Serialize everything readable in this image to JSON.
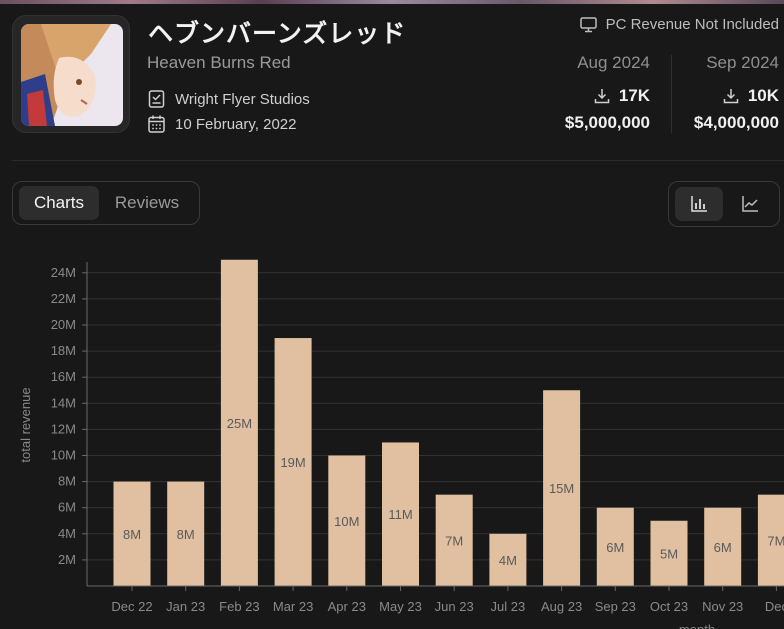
{
  "app": {
    "title": "ヘブンバーンズレッド",
    "subtitle": "Heaven Burns Red",
    "developer": "Wright Flyer Studios",
    "release_date": "10 February, 2022",
    "pc_note": "PC Revenue Not Included"
  },
  "stats": [
    {
      "month": "Aug 2024",
      "downloads": "17K",
      "revenue": "$5,000,000"
    },
    {
      "month": "Sep 2024",
      "downloads": "10K",
      "revenue": "$4,000,000"
    }
  ],
  "tabs": {
    "charts": "Charts",
    "reviews": "Reviews",
    "active": "Charts"
  },
  "view_toggle": {
    "active": "bar-chart",
    "options": [
      "bar-chart",
      "line-chart"
    ]
  },
  "icons": {
    "monitor": "monitor-icon",
    "developer": "developer-icon",
    "calendar": "calendar-icon",
    "download": "download-icon"
  },
  "colors": {
    "bar": "#e0c0a0",
    "background": "#181818",
    "bar_label": "#5a5a5a"
  },
  "chart_data": {
    "type": "bar",
    "categories": [
      "Dec 22",
      "Jan 23",
      "Feb 23",
      "Mar 23",
      "Apr 23",
      "May 23",
      "Jun 23",
      "Jul 23",
      "Aug 23",
      "Sep 23",
      "Oct 23",
      "Nov 23",
      "Dec"
    ],
    "values": [
      8000000,
      8000000,
      25000000,
      19000000,
      10000000,
      11000000,
      7000000,
      4000000,
      15000000,
      6000000,
      5000000,
      6000000,
      7000000
    ],
    "value_labels": [
      "8M",
      "8M",
      "25M",
      "19M",
      "10M",
      "11M",
      "7M",
      "4M",
      "15M",
      "6M",
      "5M",
      "6M",
      "7M"
    ],
    "ylabel": "total revenue",
    "xlabel": "month",
    "yticks": [
      "2M",
      "4M",
      "6M",
      "8M",
      "10M",
      "12M",
      "14M",
      "16M",
      "18M",
      "20M",
      "22M",
      "24M"
    ],
    "ylim": [
      0,
      25000000
    ],
    "grid": true
  }
}
